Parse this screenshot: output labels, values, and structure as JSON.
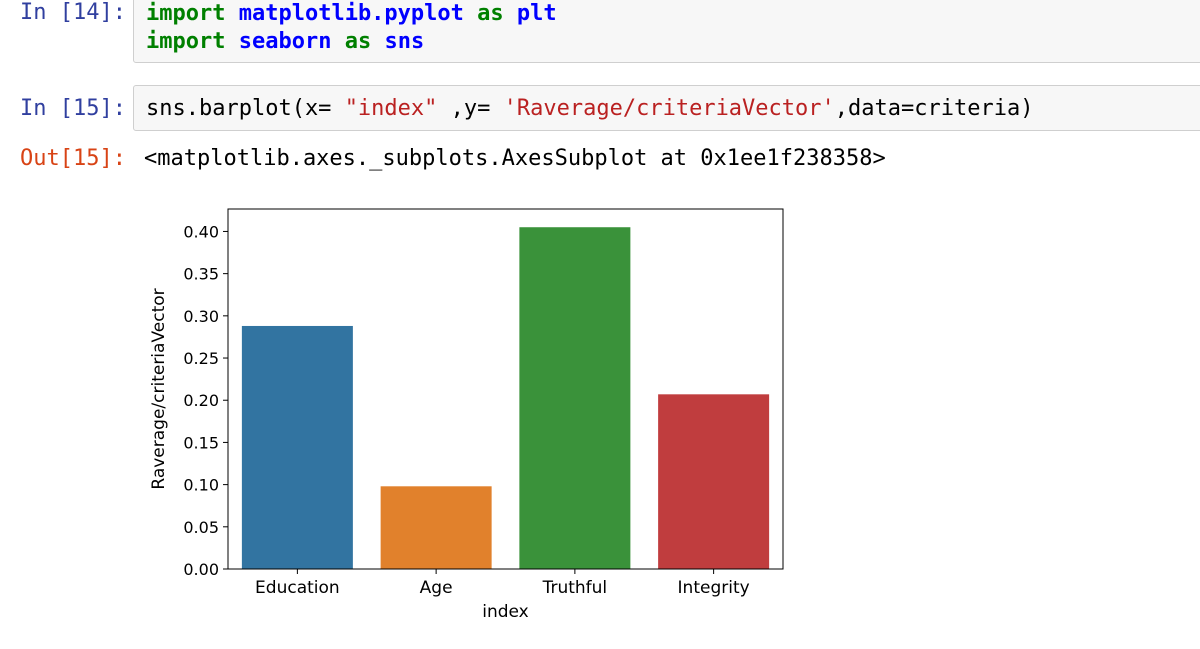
{
  "cell14": {
    "prompt": "In [14]:",
    "line1": {
      "kw": "import",
      "module": "matplotlib.pyplot",
      "as": "as",
      "alias": "plt"
    },
    "line2": {
      "kw": "import",
      "module": "seaborn",
      "as": "as",
      "alias": "sns"
    }
  },
  "cell15": {
    "prompt": "In [15]:",
    "code_pre": "sns.barplot(x= ",
    "code_str1": "\"index\"",
    "code_mid": " ,y= ",
    "code_str2": "'Raverage/criteriaVector'",
    "code_post": ",data=criteria)"
  },
  "out15": {
    "prompt": "Out[15]:",
    "text": "<matplotlib.axes._subplots.AxesSubplot at 0x1ee1f238358>"
  },
  "chart_data": {
    "type": "bar",
    "categories": [
      "Education",
      "Age",
      "Truthful",
      "Integrity"
    ],
    "values": [
      0.288,
      0.098,
      0.405,
      0.207
    ],
    "colors": [
      "#3274a1",
      "#e1812c",
      "#3a923a",
      "#c03d3e"
    ],
    "xlabel": "index",
    "ylabel": "Raverage/criteriaVector",
    "ylim": [
      0,
      0.4266
    ],
    "yticks": [
      0,
      0.05,
      0.1,
      0.15,
      0.2,
      0.25,
      0.3,
      0.35,
      0.4
    ],
    "ytick_labels": [
      "0.00",
      "0.05",
      "0.10",
      "0.15",
      "0.20",
      "0.25",
      "0.30",
      "0.35",
      "0.40"
    ],
    "grid": false
  }
}
